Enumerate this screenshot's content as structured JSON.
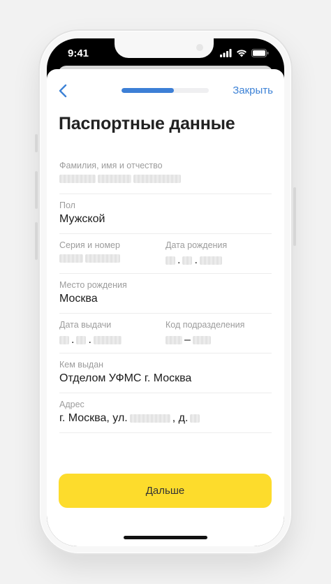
{
  "status_bar": {
    "time": "9:41",
    "icons": [
      "signal-icon",
      "wifi-icon",
      "battery-icon"
    ]
  },
  "header": {
    "back_icon": "chevron-left-icon",
    "progress": 0.6,
    "close_label": "Закрыть"
  },
  "title": "Паспортные данные",
  "fields": {
    "full_name": {
      "label": "Фамилия, имя и отчество"
    },
    "gender": {
      "label": "Пол",
      "value": "Мужской"
    },
    "series_number": {
      "label": "Серия и номер"
    },
    "birth_date": {
      "label": "Дата рождения",
      "sep1": ".",
      "sep2": "."
    },
    "birth_place": {
      "label": "Место рождения",
      "value": "Москва"
    },
    "issue_date": {
      "label": "Дата выдачи",
      "sep1": ".",
      "sep2": "."
    },
    "division_code": {
      "label": "Код подразделения",
      "sep": "–"
    },
    "issued_by": {
      "label": "Кем выдан",
      "value": "Отделом УФМС г. Москва"
    },
    "address": {
      "label": "Адрес",
      "prefix": "г. Москва, ул.",
      "house": ", д."
    }
  },
  "next_button": {
    "label": "Дальше"
  },
  "colors": {
    "accent_blue": "#3d82d6",
    "button_yellow": "#fddc2c",
    "label_gray": "#9c9c9c"
  }
}
